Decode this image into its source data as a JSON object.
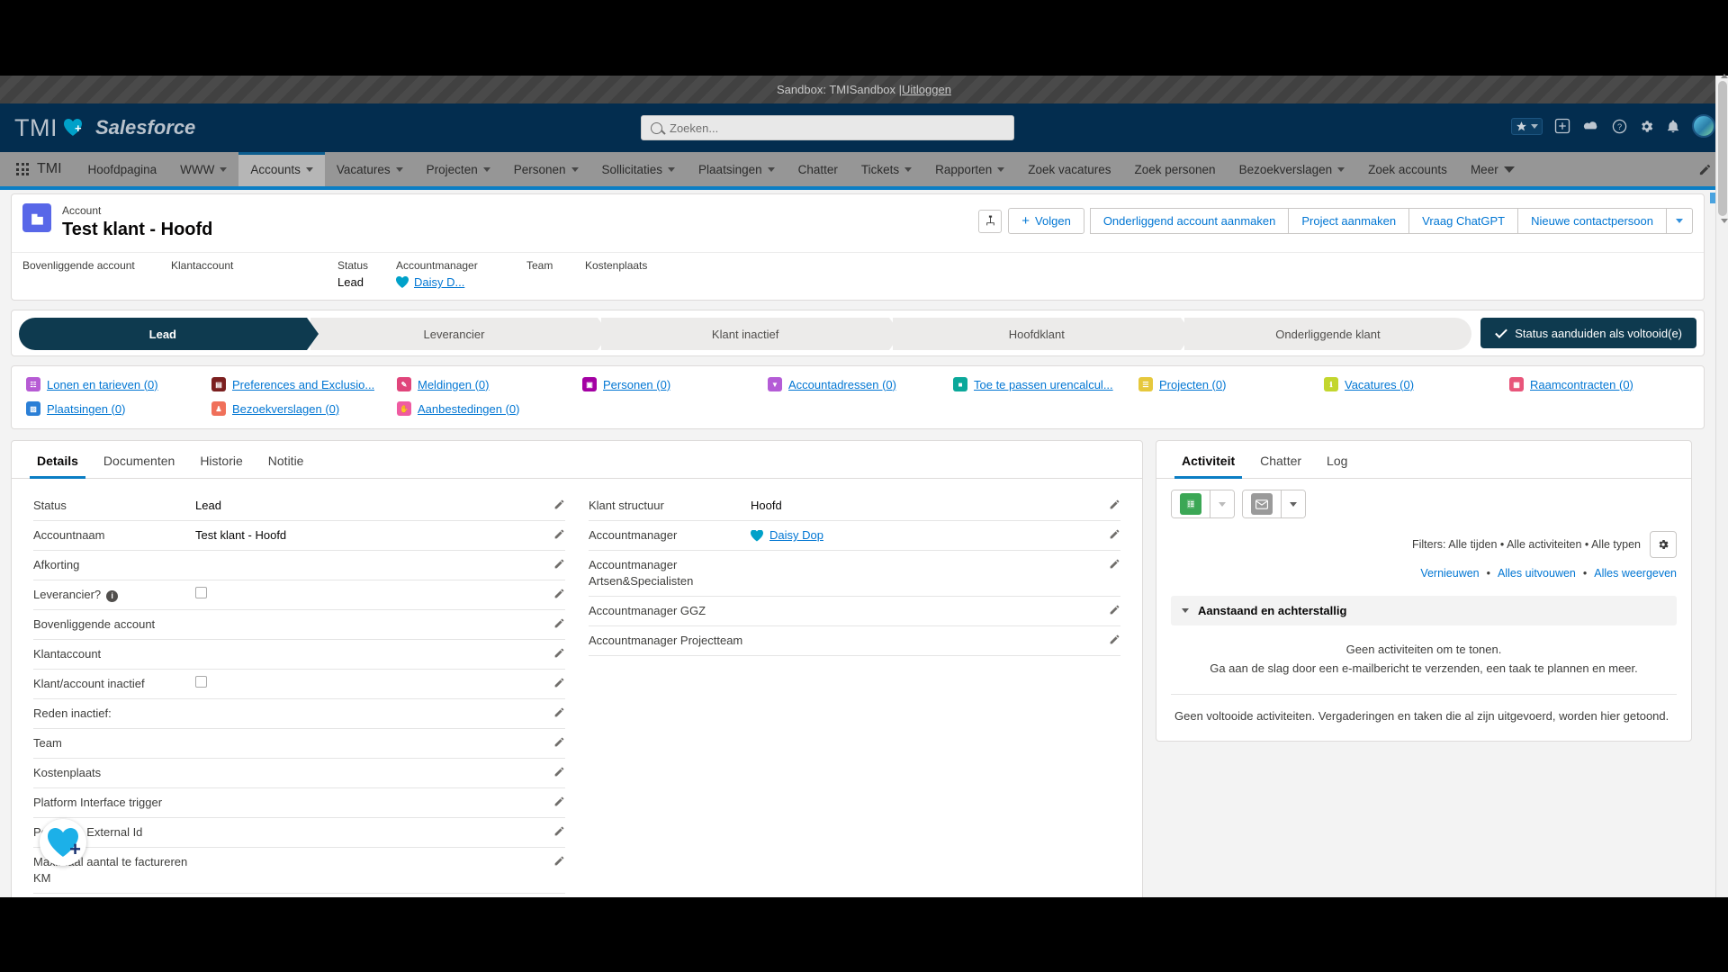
{
  "sandbox": {
    "text": "Sandbox: TMISandbox | ",
    "logout_label": "Uitloggen"
  },
  "brand": {
    "tmi": "TMI",
    "salesforce": "Salesforce"
  },
  "search": {
    "placeholder": "Zoeken...",
    "icon": "search-icon"
  },
  "global_header_icons": [
    {
      "name": "favorites-icon"
    },
    {
      "name": "app-launcher-plus-icon"
    },
    {
      "name": "cloud-icon"
    },
    {
      "name": "help-icon"
    },
    {
      "name": "setup-gear-icon"
    },
    {
      "name": "notifications-bell-icon"
    },
    {
      "name": "user-avatar"
    }
  ],
  "nav": {
    "app_name": "TMI",
    "waffle_icon": "app-launcher-icon",
    "pencil_icon": "edit-pencil-icon",
    "items": [
      {
        "label": "Hoofdpagina",
        "has_caret": false,
        "active": false
      },
      {
        "label": "WWW",
        "has_caret": true,
        "active": false
      },
      {
        "label": "Accounts",
        "has_caret": true,
        "active": true
      },
      {
        "label": "Vacatures",
        "has_caret": true,
        "active": false
      },
      {
        "label": "Projecten",
        "has_caret": true,
        "active": false
      },
      {
        "label": "Personen",
        "has_caret": true,
        "active": false
      },
      {
        "label": "Sollicitaties",
        "has_caret": true,
        "active": false
      },
      {
        "label": "Plaatsingen",
        "has_caret": true,
        "active": false
      },
      {
        "label": "Chatter",
        "has_caret": false,
        "active": false
      },
      {
        "label": "Tickets",
        "has_caret": true,
        "active": false
      },
      {
        "label": "Rapporten",
        "has_caret": true,
        "active": false
      },
      {
        "label": "Zoek vacatures",
        "has_caret": false,
        "active": false
      },
      {
        "label": "Zoek personen",
        "has_caret": false,
        "active": false
      },
      {
        "label": "Bezoekverslagen",
        "has_caret": true,
        "active": false
      },
      {
        "label": "Zoek accounts",
        "has_caret": false,
        "active": false
      },
      {
        "label": "Meer",
        "has_caret": true,
        "active": false,
        "solid_caret": true
      }
    ]
  },
  "record": {
    "object_label": "Account",
    "title": "Test klant - Hoofd",
    "icon": "account-building-icon",
    "hierarchy_icon": "account-hierarchy-icon",
    "follow_label": "Volgen",
    "actions": [
      {
        "label": "Onderliggend account aanmaken"
      },
      {
        "label": "Project aanmaken"
      },
      {
        "label": "Vraag ChatGPT"
      },
      {
        "label": "Nieuwe contactpersoon"
      }
    ],
    "more_caret_icon": "chevron-down-icon",
    "highlight_fields": [
      {
        "label": "Bovenliggende account",
        "value": "",
        "is_link": false
      },
      {
        "label": "Klantaccount",
        "value": "",
        "is_link": false
      },
      {
        "label": "Status",
        "value": "Lead",
        "is_link": false
      },
      {
        "label": "Accountmanager",
        "value": "Daisy D...",
        "is_link": true,
        "has_avatar": true
      },
      {
        "label": "Team",
        "value": "",
        "is_link": false
      },
      {
        "label": "Kostenplaats",
        "value": "",
        "is_link": false
      }
    ]
  },
  "path": {
    "steps": [
      "Lead",
      "Leverancier",
      "Klant inactief",
      "Hoofdklant",
      "Onderliggende klant"
    ],
    "current_index": 0,
    "complete_button": "Status aanduiden als voltooid(e)",
    "complete_icon": "check-icon"
  },
  "quick_links": [
    {
      "label": "Lonen en tarieven (0)",
      "color": "#b65bd4",
      "glyph": "☷"
    },
    {
      "label": "Preferences and Exclusio...",
      "color": "#7b1f1f",
      "glyph": "▤"
    },
    {
      "label": "Meldingen (0)",
      "color": "#e0457b",
      "glyph": "✎"
    },
    {
      "label": "Personen (0)",
      "color": "#a300a3",
      "glyph": "▣"
    },
    {
      "label": "Accountadressen (0)",
      "color": "#b45cd6",
      "glyph": "▼"
    },
    {
      "label": "Toe te passen urencalcul...",
      "color": "#0ba89a",
      "glyph": "■"
    },
    {
      "label": "Projecten (0)",
      "color": "#e6c83c",
      "glyph": "☰"
    },
    {
      "label": "Vacatures (0)",
      "color": "#c3d62e",
      "glyph": "ℹ"
    },
    {
      "label": "Raamcontracten (0)",
      "color": "#e8557a",
      "glyph": "▦"
    },
    {
      "label": "Plaatsingen (0)",
      "color": "#2b7fd6",
      "glyph": "▨"
    },
    {
      "label": "Bezoekverslagen (0)",
      "color": "#f0705a",
      "glyph": "♟"
    },
    {
      "label": "Aanbestedingen (0)",
      "color": "#ef5ba1",
      "glyph": "✋"
    }
  ],
  "detail_panel": {
    "tabs": [
      {
        "label": "Details",
        "active": true
      },
      {
        "label": "Documenten",
        "active": false
      },
      {
        "label": "Historie",
        "active": false
      },
      {
        "label": "Notitie",
        "active": false
      }
    ],
    "left_fields": [
      {
        "label": "Status",
        "value": "Lead",
        "type": "text"
      },
      {
        "label": "Accountnaam",
        "value": "Test klant - Hoofd",
        "type": "text"
      },
      {
        "label": "Afkorting",
        "value": "",
        "type": "text"
      },
      {
        "label": "Leverancier?",
        "value": "",
        "type": "checkbox",
        "info": true
      },
      {
        "label": "Bovenliggende account",
        "value": "",
        "type": "text"
      },
      {
        "label": "Klantaccount",
        "value": "",
        "type": "text"
      },
      {
        "label": "Klant/account inactief",
        "value": "",
        "type": "checkbox"
      },
      {
        "label": "Reden inactief:",
        "value": "",
        "type": "text"
      },
      {
        "label": "Team",
        "value": "",
        "type": "text"
      },
      {
        "label": "Kostenplaats",
        "value": "",
        "type": "text"
      },
      {
        "label": "Platform Interface trigger",
        "value": "",
        "type": "text"
      },
      {
        "label": "Personen External Id",
        "value": "",
        "type": "text"
      },
      {
        "label": "Maximaal aantal te factureren KM",
        "value": "",
        "type": "text"
      }
    ],
    "right_fields": [
      {
        "label": "Klant structuur",
        "value": "Hoofd",
        "type": "text"
      },
      {
        "label": "Accountmanager",
        "value": "Daisy Dop",
        "type": "link",
        "has_avatar": true
      },
      {
        "label": "Accountmanager Artsen&Specialisten",
        "value": "",
        "type": "text"
      },
      {
        "label": "Accountmanager GGZ",
        "value": "",
        "type": "text"
      },
      {
        "label": "Accountmanager Projectteam",
        "value": "",
        "type": "text"
      }
    ],
    "edit_icon": "edit-pencil-icon"
  },
  "activity_panel": {
    "tabs": [
      {
        "label": "Activiteit",
        "active": true
      },
      {
        "label": "Chatter",
        "active": false
      },
      {
        "label": "Log",
        "active": false
      }
    ],
    "task_icon": "new-task-icon",
    "email_icon": "new-email-icon",
    "filters_label": "Filters: Alle tijden • Alle activiteiten • Alle typen",
    "gear_icon": "filter-settings-gear-icon",
    "refresh_label": "Vernieuwen",
    "expand_all_label": "Alles uitvouwen",
    "view_all_label": "Alles weergeven",
    "section_title": "Aanstaand en achterstallig",
    "section_chevron": "chevron-down-icon",
    "empty_line1": "Geen activiteiten om te tonen.",
    "empty_line2": "Ga aan de slag door een e-mailbericht te verzenden, een taak te plannen en meer.",
    "completed_empty": "Geen voltooide activiteiten. Vergaderingen en taken die al zijn uitgevoerd, worden hier getoond."
  },
  "floating_button": {
    "name": "add-heart-floating-button",
    "icon": "heart-plus-icon"
  },
  "colors": {
    "header_blue": "#032d4f",
    "nav_gray": "#969696",
    "link_blue": "#0176d3",
    "path_dark": "#0e3a4f",
    "accent_blue": "#0b7ec4"
  }
}
